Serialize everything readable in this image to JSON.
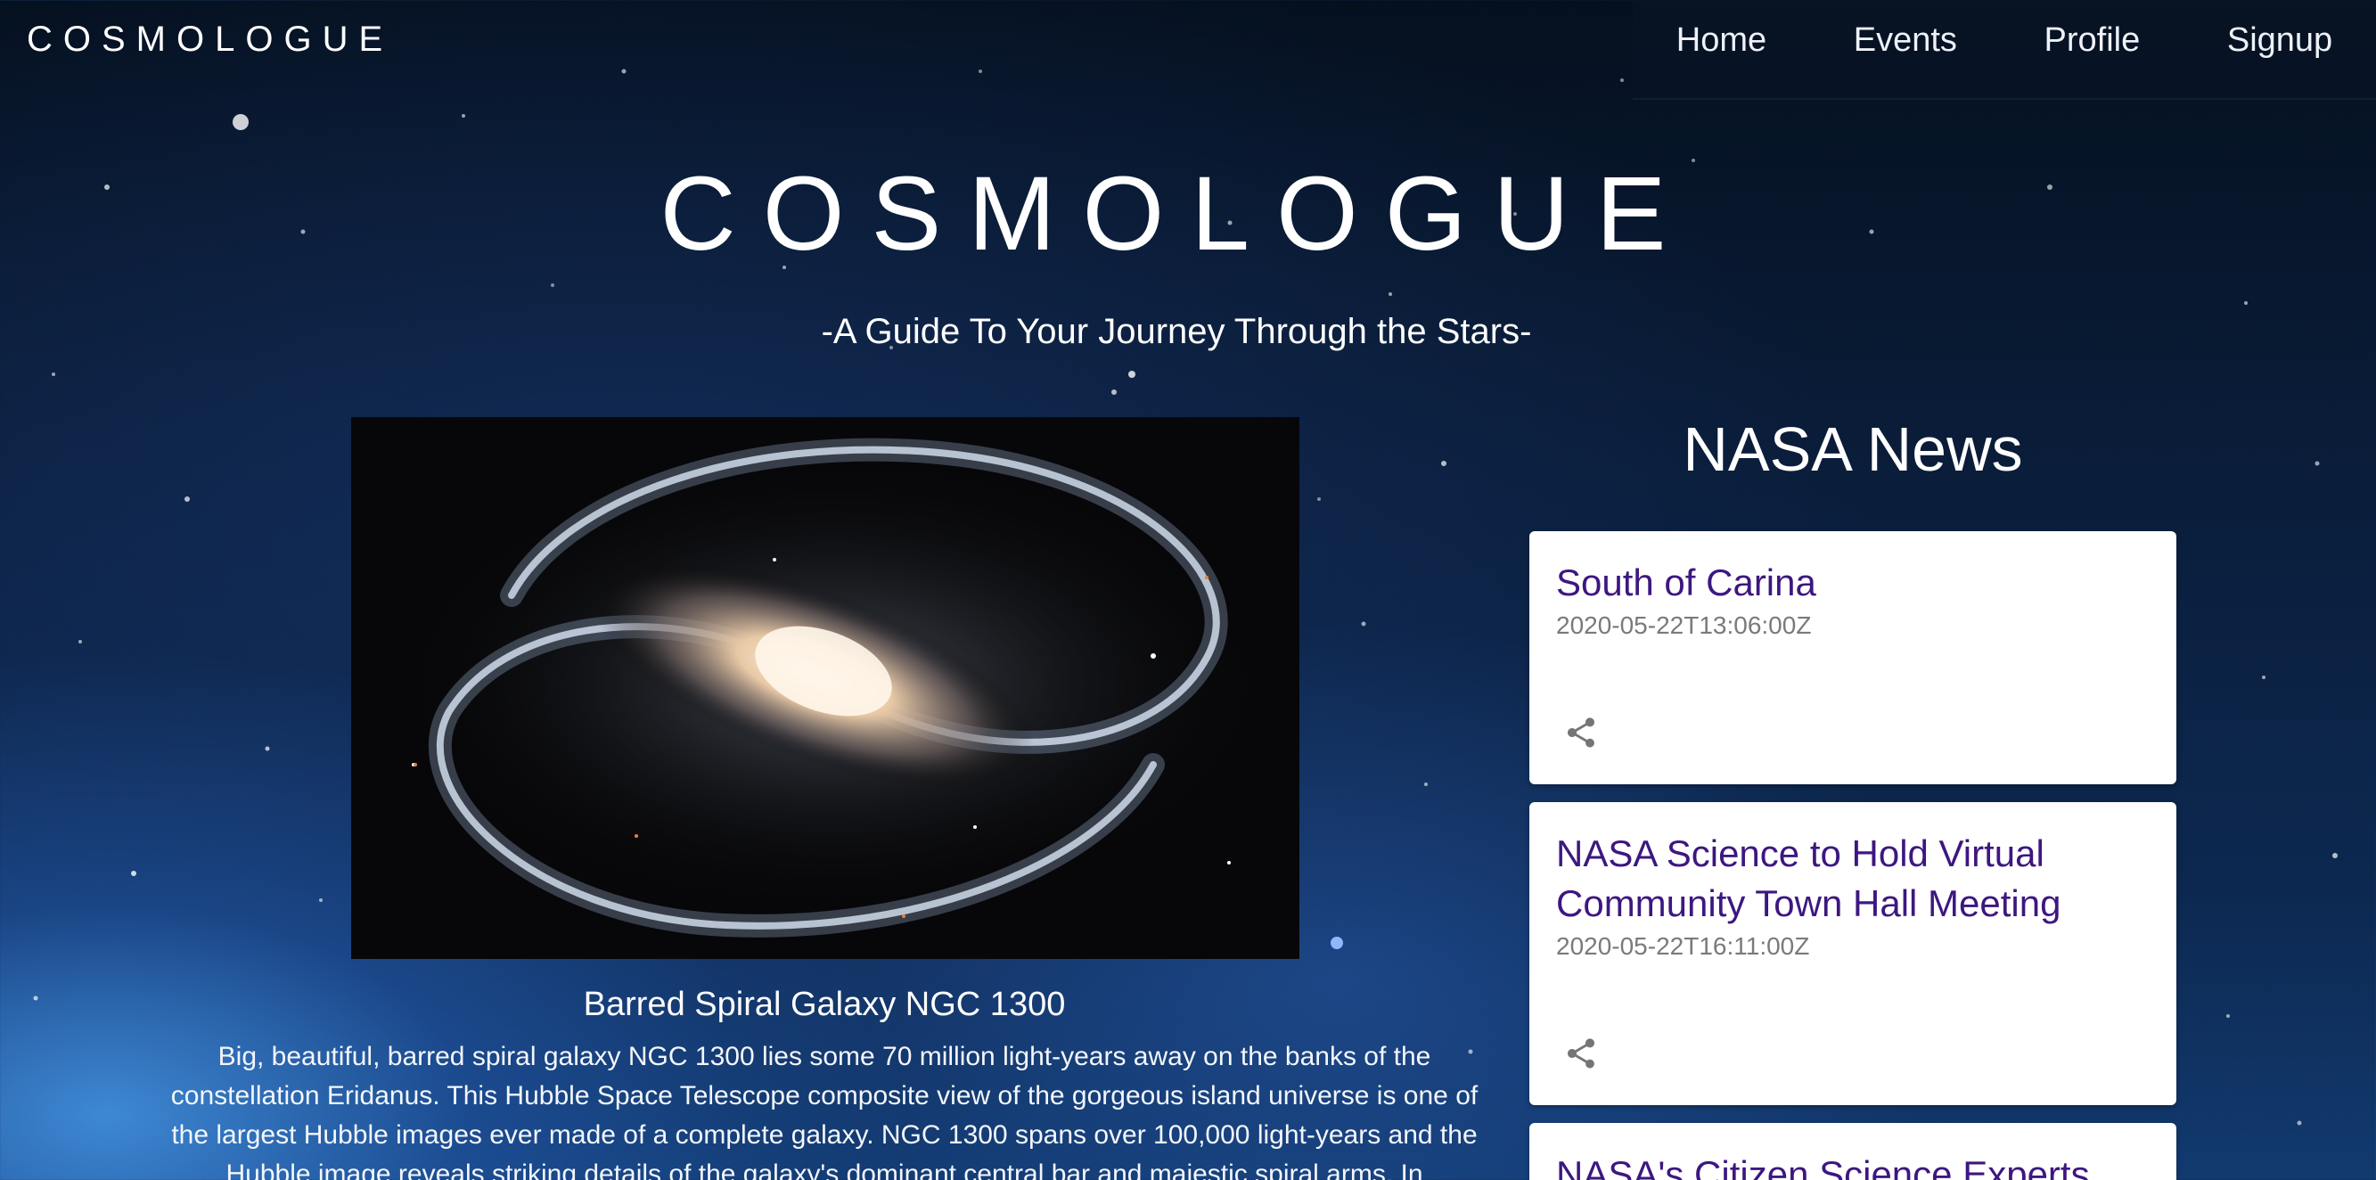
{
  "nav": {
    "brand": "COSMOLOGUE",
    "links": [
      "Home",
      "Events",
      "Profile",
      "Signup"
    ]
  },
  "hero": {
    "title": "COSMOLOGUE",
    "subtitle": "-A Guide To Your Journey Through the Stars-"
  },
  "apod": {
    "title": "Barred Spiral Galaxy NGC 1300",
    "description": "Big, beautiful, barred spiral galaxy NGC 1300 lies some 70 million light-years away on the banks of the constellation Eridanus. This Hubble Space Telescope composite view of the gorgeous island universe is one of the largest Hubble images ever made of a complete galaxy. NGC 1300 spans over 100,000 light-years and the Hubble image reveals striking details of the galaxy's dominant central bar and majestic spiral arms. In"
  },
  "news": {
    "heading": "NASA News",
    "items": [
      {
        "title": "South of Carina",
        "date": "2020-05-22T13:06:00Z",
        "icon": "share-icon"
      },
      {
        "title": "NASA Science to Hold Virtual Community Town Hall Meeting",
        "date": "2020-05-22T16:11:00Z",
        "icon": "share-icon"
      },
      {
        "title": "NASA's Citizen Science Experts",
        "date": "",
        "icon": "share-icon"
      }
    ]
  },
  "colors": {
    "news_title": "#3d1780",
    "news_date": "#7a7a7a",
    "card_bg": "#ffffff"
  }
}
